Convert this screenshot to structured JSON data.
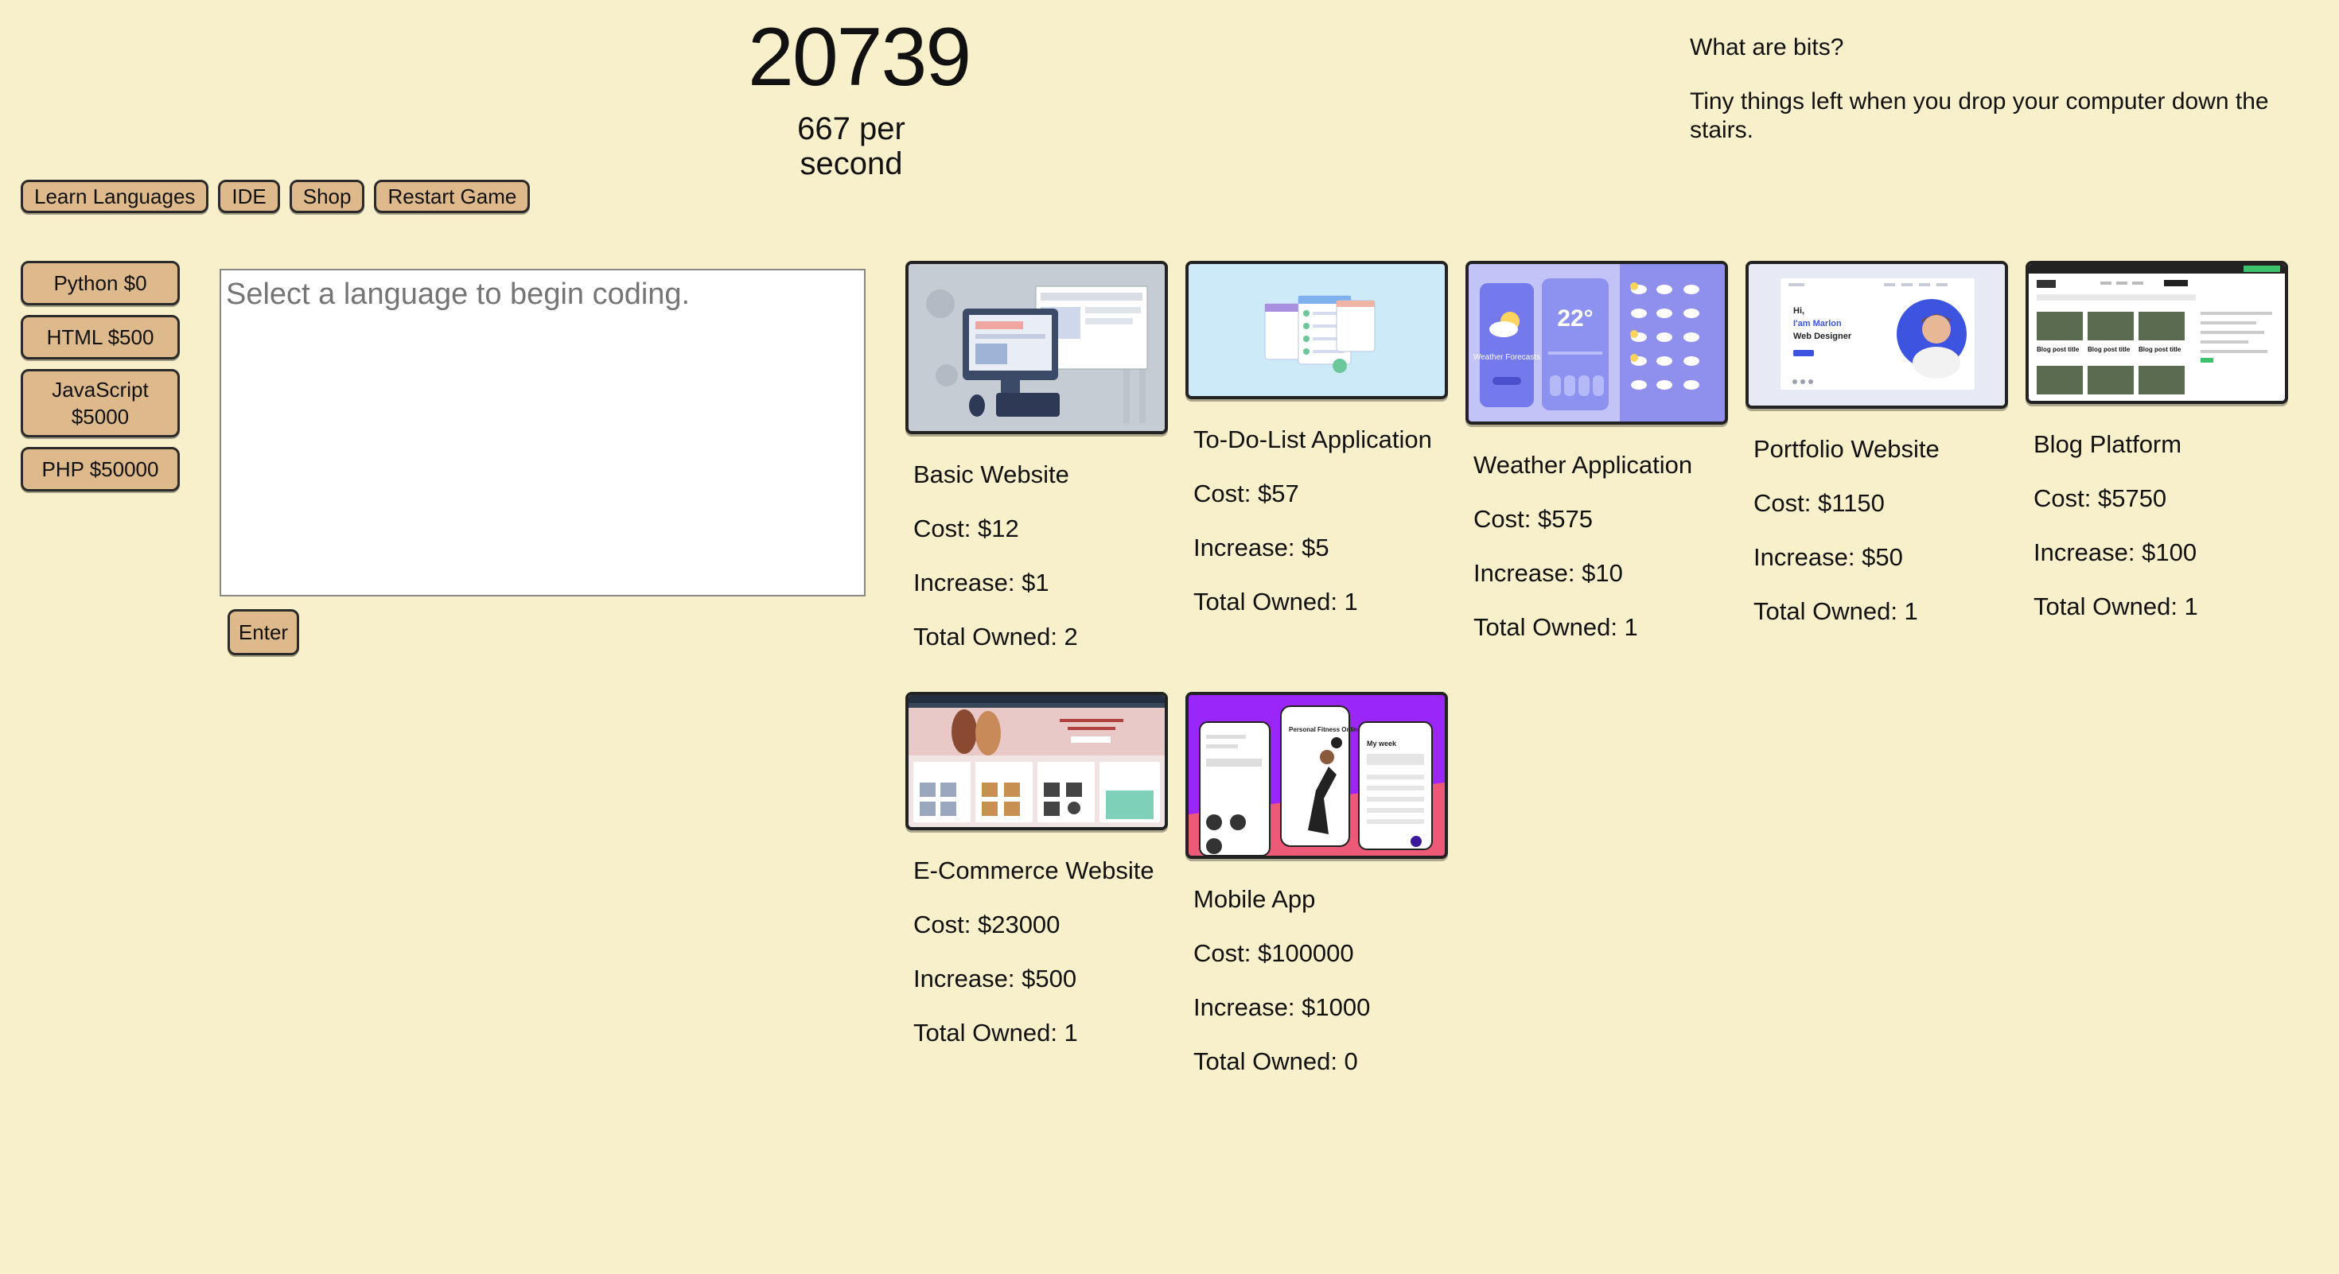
{
  "counter": {
    "count": "20739",
    "rate": "667 per second"
  },
  "joke": {
    "question": "What are bits?",
    "answer": "Tiny things left when you drop your computer down the stairs."
  },
  "nav": {
    "learn": "Learn Languages",
    "ide": "IDE",
    "shop": "Shop",
    "restart": "Restart Game"
  },
  "languages": [
    {
      "label": "Python $0"
    },
    {
      "label": "HTML $500"
    },
    {
      "label": "JavaScript $5000"
    },
    {
      "label": "PHP $50000"
    }
  ],
  "editor": {
    "placeholder": "Select a language to begin coding.",
    "enter": "Enter"
  },
  "projects": [
    {
      "name": "Basic Website",
      "cost": "Cost: $12",
      "increase": "Increase: $1",
      "owned": "Total Owned: 2"
    },
    {
      "name": "To-Do-List Application",
      "cost": "Cost: $57",
      "increase": "Increase: $5",
      "owned": "Total Owned: 1"
    },
    {
      "name": "Weather Application",
      "cost": "Cost: $575",
      "increase": "Increase: $10",
      "owned": "Total Owned: 1"
    },
    {
      "name": "Portfolio Website",
      "cost": "Cost: $1150",
      "increase": "Increase: $50",
      "owned": "Total Owned: 1"
    },
    {
      "name": "Blog Platform",
      "cost": "Cost: $5750",
      "increase": "Increase: $100",
      "owned": "Total Owned: 1"
    },
    {
      "name": "E-Commerce Website",
      "cost": "Cost: $23000",
      "increase": "Increase: $500",
      "owned": "Total Owned: 1"
    },
    {
      "name": "Mobile App",
      "cost": "Cost: $100000",
      "increase": "Increase: $1000",
      "owned": "Total Owned: 0"
    }
  ],
  "thumbs": {
    "weather_temp": "22°",
    "weather_title": "Weather Forecasts",
    "portfolio_hi": "Hi,",
    "portfolio_name": "I'am Marlon",
    "portfolio_role": "Web Designer",
    "blog_post": "Blog post title",
    "mobile_headline": "Personal Fitness Online App",
    "mobile_week": "My week"
  },
  "colors": {
    "background": "#f8f0cb",
    "button": "#ddb98b",
    "border": "#2a2a2a"
  }
}
